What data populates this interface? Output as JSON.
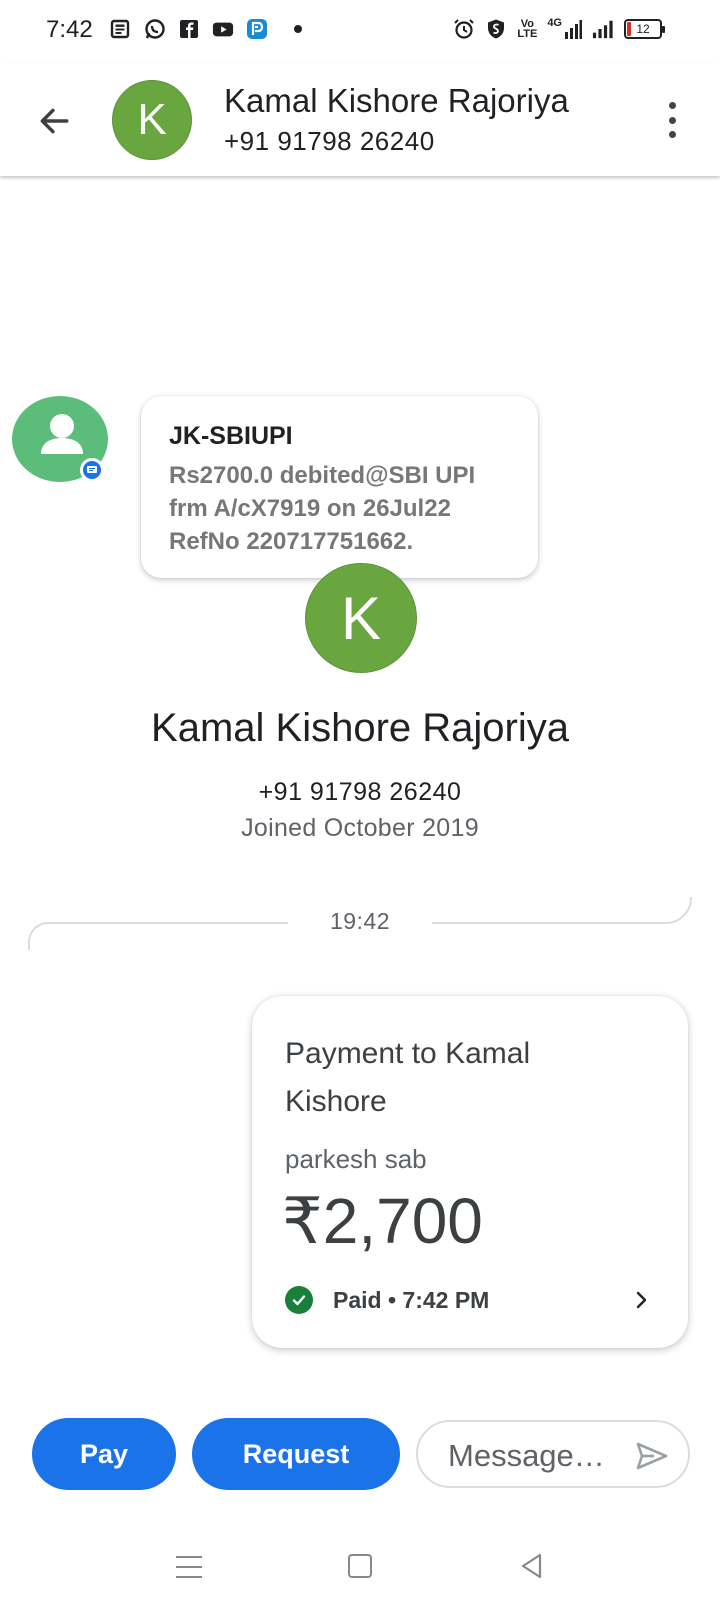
{
  "status_bar": {
    "time": "7:42",
    "left_icons": [
      "news-icon",
      "whatsapp-icon",
      "facebook-icon",
      "youtube-icon",
      "app-p-icon"
    ],
    "right_icons": [
      "alarm-icon",
      "shield-icon",
      "volte-icon",
      "4g-signal-icon",
      "signal-icon"
    ],
    "net_label_1": "Vo",
    "net_label_2": "LTE",
    "net_label_3": "4G",
    "battery_level": "12",
    "battery_color": "#d93025"
  },
  "app_bar": {
    "avatar_initial": "K",
    "contact_name": "Kamal Kishore Rajoriya",
    "contact_phone": "+91 91798 26240",
    "avatar_color": "#6aa640"
  },
  "sms_notification": {
    "sender": "JK-SBIUPI",
    "body": "Rs2700.0 debited@SBI UPI frm A/cX7919 on 26Jul22 RefNo 220717751662.",
    "avatar_color": "#5cbd7a"
  },
  "profile": {
    "avatar_initial": "K",
    "name": "Kamal Kishore Rajoriya",
    "phone": "+91 91798 26240",
    "joined": "Joined October 2019"
  },
  "timeline": {
    "time": "19:42"
  },
  "payment_card": {
    "title": "Payment to Kamal Kishore",
    "note": "parkesh sab",
    "amount": "₹2,700",
    "status": "Paid • 7:42 PM",
    "status_color": "#188038"
  },
  "actions": {
    "pay_label": "Pay",
    "request_label": "Request",
    "message_placeholder": "Message…",
    "accent_color": "#1a73e8"
  }
}
